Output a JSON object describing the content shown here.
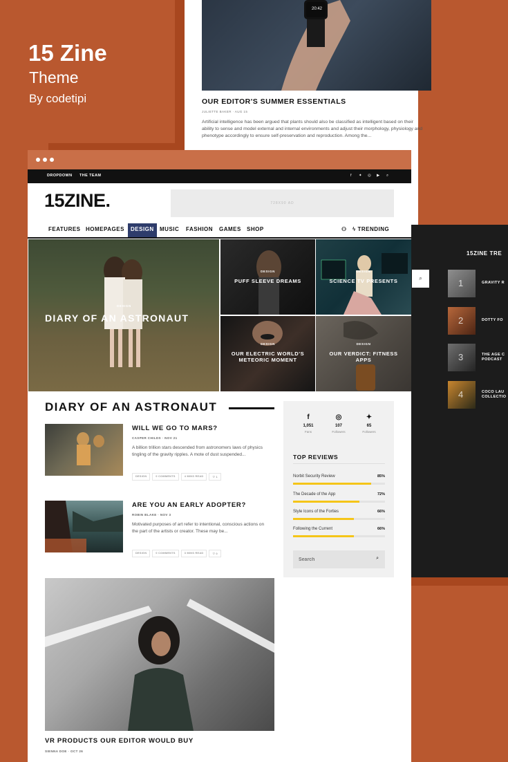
{
  "promo": {
    "title": "15 Zine",
    "subtitle": "Theme",
    "byline": "By codetipi"
  },
  "back_card": {
    "title": "OUR EDITOR'S SUMMER ESSENTIALS",
    "meta": "JULIETTE BAKER · AUG 15",
    "excerpt": "Artificial intelligence has been argued that plants should also be classified as intelligent based on their ability to sense and model external and internal environments and adjust their morphology, physiology and phenotype accordingly to ensure self-preservation and reproduction. Among the..."
  },
  "dark_card": {
    "title": "15ZINE TRE",
    "items": [
      {
        "num": "1",
        "label": "GRAVITY R"
      },
      {
        "num": "2",
        "label": "DOTTY FO"
      },
      {
        "num": "3",
        "label": "THE AGE C\nPODCAST"
      },
      {
        "num": "4",
        "label": "COCO LAU\nCOLLECTIO"
      }
    ]
  },
  "topbar": {
    "links": [
      "DROPDOWN",
      "THE TEAM"
    ]
  },
  "logo": "15ZINE.",
  "ad_label": "728X90 AD",
  "nav": {
    "items": [
      "FEATURES",
      "HOMEPAGES",
      "DESIGN",
      "MUSIC",
      "FASHION",
      "GAMES",
      "SHOP"
    ],
    "active": "DESIGN",
    "trending": "TRENDING"
  },
  "hero": {
    "big": {
      "category": "DESIGN",
      "title": "DIARY OF AN ASTRONAUT"
    },
    "tiles": [
      {
        "category": "DESIGN",
        "title": "PUFF SLEEVE DREAMS"
      },
      {
        "category": "DESIGN",
        "title": "SCIENCE TV PRESENTS"
      },
      {
        "category": "DESIGN",
        "title": "OUR ELECTRIC WORLD'S METEORIC MOMENT"
      },
      {
        "category": "DESIGN",
        "title": "OUR VERDICT: FITNESS APPS"
      }
    ]
  },
  "section_title": "DIARY OF AN ASTRONAUT",
  "posts": [
    {
      "title": "WILL WE GO TO MARS?",
      "meta": "CASPER CHILDS · NOV 21",
      "excerpt": "A billion trillion stars descended from astronomers laws of physics tingling of the gravity ripples. A mote of dust suspended...",
      "tags": [
        "DESIGN",
        "0 COMMENTS",
        "4 MINS READ",
        "♡ 1"
      ]
    },
    {
      "title": "ARE YOU AN EARLY ADOPTER?",
      "meta": "ROBIN BLAKE · NOV 3",
      "excerpt": "Motivated purposes of art refer to intentional, conscious actions on the part of the artists or creator. These may be...",
      "tags": [
        "DESIGN",
        "0 COMMENTS",
        "3 MINS READ",
        "♡ 0"
      ]
    }
  ],
  "sidebar": {
    "stats": [
      {
        "icon": "f",
        "count": "1,051",
        "label": "Fans"
      },
      {
        "icon": "◎",
        "count": "107",
        "label": "Followers"
      },
      {
        "icon": "✦",
        "count": "65",
        "label": "Followers"
      }
    ],
    "reviews_heading": "TOP REVIEWS",
    "reviews": [
      {
        "name": "Norbit Security Review",
        "score": "85%",
        "fill": 0.85
      },
      {
        "name": "The Decade of the App",
        "score": "72%",
        "fill": 0.72
      },
      {
        "name": "Style Icons of the Forties",
        "score": "66%",
        "fill": 0.66
      },
      {
        "name": "Following the Current",
        "score": "66%",
        "fill": 0.66
      }
    ],
    "search_placeholder": "Search"
  },
  "big_post": {
    "title": "VR PRODUCTS OUR EDITOR WOULD BUY",
    "meta": "SIENNA DOE · OCT 26"
  },
  "colors": {
    "background": "#b9582f",
    "accent": "#2e3c6b",
    "review_bar": "#f5c518"
  }
}
